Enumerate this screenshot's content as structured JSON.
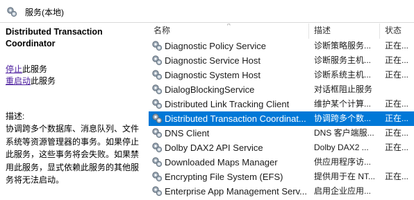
{
  "header": {
    "title": "服务(本地)",
    "icon": "gear-icon"
  },
  "left_panel": {
    "service_name": "Distributed Transaction Coordinator",
    "stop_link": "停止",
    "stop_suffix": "此服务",
    "restart_link": "重启动",
    "restart_suffix": "此服务",
    "desc_label": "描述:",
    "desc_text": "协调跨多个数据库、消息队列、文件系统等资源管理器的事务。如果停止此服务，这些事务将会失败。如果禁用此服务，显式依赖此服务的其他服务将无法启动。"
  },
  "table": {
    "columns": {
      "name": "名称",
      "desc": "描述",
      "status": "状态"
    },
    "rows": [
      {
        "name": "Diagnostic Policy Service",
        "desc": "诊断策略服务...",
        "status": "正在..."
      },
      {
        "name": "Diagnostic Service Host",
        "desc": "诊断服务主机...",
        "status": "正在..."
      },
      {
        "name": "Diagnostic System Host",
        "desc": "诊断系统主机...",
        "status": "正在..."
      },
      {
        "name": "DialogBlockingService",
        "desc": "对话框阻止服务",
        "status": ""
      },
      {
        "name": "Distributed Link Tracking Client",
        "desc": "维护某个计算...",
        "status": "正在..."
      },
      {
        "name": "Distributed Transaction Coordinat...",
        "desc": "协调跨多个数...",
        "status": "正在...",
        "selected": true
      },
      {
        "name": "DNS Client",
        "desc": "DNS 客户端服...",
        "status": "正在..."
      },
      {
        "name": "Dolby DAX2 API Service",
        "desc": "Dolby DAX2 ...",
        "status": "正在..."
      },
      {
        "name": "Downloaded Maps Manager",
        "desc": "供应用程序访...",
        "status": ""
      },
      {
        "name": "Encrypting File System (EFS)",
        "desc": "提供用于在 NT...",
        "status": "正在..."
      },
      {
        "name": "Enterprise App Management Serv...",
        "desc": "启用企业应用...",
        "status": ""
      }
    ]
  },
  "colors": {
    "selection": "#0078d7",
    "link": "#4b1c9e"
  }
}
